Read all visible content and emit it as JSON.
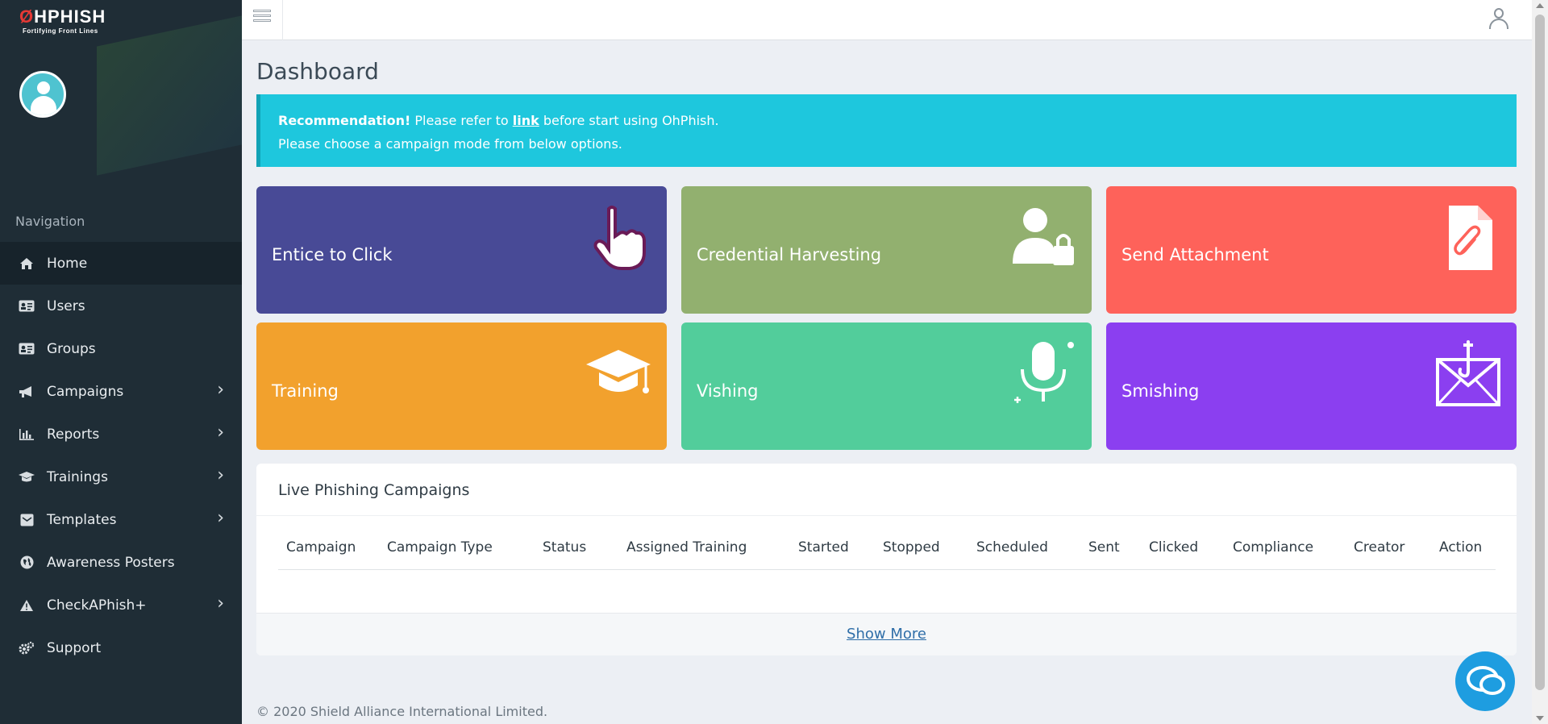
{
  "brand": {
    "name_prefix": "Ø",
    "name": "HPHISH",
    "tagline": "Fortifying Front Lines"
  },
  "sidebar": {
    "heading": "Navigation",
    "items": [
      {
        "label": "Home",
        "icon": "home-icon",
        "active": true,
        "has_submenu": false
      },
      {
        "label": "Users",
        "icon": "id-card-icon",
        "active": false,
        "has_submenu": false
      },
      {
        "label": "Groups",
        "icon": "id-card-icon",
        "active": false,
        "has_submenu": false
      },
      {
        "label": "Campaigns",
        "icon": "megaphone-icon",
        "active": false,
        "has_submenu": true
      },
      {
        "label": "Reports",
        "icon": "bar-chart-icon",
        "active": false,
        "has_submenu": true
      },
      {
        "label": "Trainings",
        "icon": "graduation-cap-icon",
        "active": false,
        "has_submenu": true
      },
      {
        "label": "Templates",
        "icon": "envelope-square-icon",
        "active": false,
        "has_submenu": true
      },
      {
        "label": "Awareness Posters",
        "icon": "globe-icon",
        "active": false,
        "has_submenu": false
      },
      {
        "label": "CheckAPhish+",
        "icon": "warning-icon",
        "active": false,
        "has_submenu": true
      },
      {
        "label": "Support",
        "icon": "cogs-icon",
        "active": false,
        "has_submenu": false
      }
    ]
  },
  "main": {
    "title": "Dashboard",
    "alert": {
      "bold": "Recommendation!",
      "text_before_link": " Please refer to ",
      "link": "link",
      "text_after_link": " before start using OhPhish.",
      "line2": "Please choose a campaign mode from below options."
    },
    "tiles": [
      {
        "label": "Entice to Click",
        "color": "#484a96",
        "icon": "pointer-hand-icon"
      },
      {
        "label": "Credential Harvesting",
        "color": "#92b06f",
        "icon": "user-lock-icon"
      },
      {
        "label": "Send Attachment",
        "color": "#fe625a",
        "icon": "attachment-file-icon"
      },
      {
        "label": "Training",
        "color": "#f2a12d",
        "icon": "graduation-cap-icon"
      },
      {
        "label": "Vishing",
        "color": "#52cd9b",
        "icon": "microphone-icon"
      },
      {
        "label": "Smishing",
        "color": "#8b3ff0",
        "icon": "envelope-hook-icon"
      }
    ],
    "live_campaigns": {
      "title": "Live Phishing Campaigns",
      "columns": [
        "Campaign",
        "Campaign Type",
        "Status",
        "Assigned Training",
        "Started",
        "Stopped",
        "Scheduled",
        "Sent",
        "Clicked",
        "Compliance",
        "Creator",
        "Action"
      ],
      "rows": [],
      "show_more": "Show More"
    },
    "footer": "© 2020 Shield Alliance International Limited."
  }
}
